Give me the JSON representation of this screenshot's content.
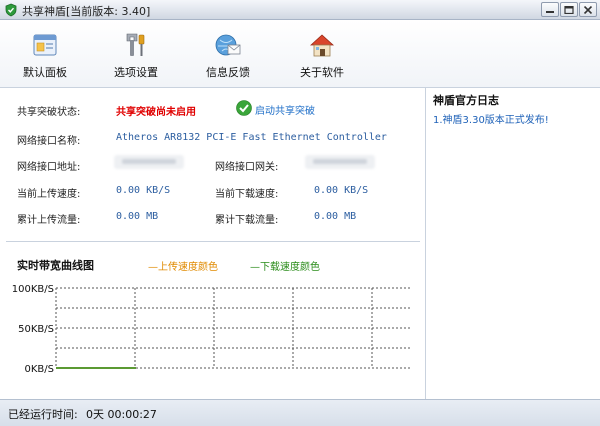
{
  "window": {
    "title": "共享神盾[当前版本: 3.40]"
  },
  "toolbar": {
    "items": [
      {
        "label": "默认面板",
        "icon": "panel-icon"
      },
      {
        "label": "选项设置",
        "icon": "tools-icon"
      },
      {
        "label": "信息反馈",
        "icon": "feedback-icon"
      },
      {
        "label": "关于软件",
        "icon": "house-icon"
      }
    ]
  },
  "status": {
    "state_label": "共享突破状态:",
    "state_value": "共享突破尚未启用",
    "start_label": "启动共享突破",
    "iface_name_label": "网络接口名称:",
    "iface_name_value": "Atheros AR8132 PCI-E Fast Ethernet Controller",
    "iface_addr_label": "网络接口地址:",
    "iface_gw_label": "网络接口网关:",
    "up_speed_label": "当前上传速度:",
    "up_speed_value": "0.00 KB/S",
    "down_speed_label": "当前下载速度:",
    "down_speed_value": "0.00 KB/S",
    "up_total_label": "累计上传流量:",
    "up_total_value": "0.00 MB",
    "down_total_label": "累计下载流量:",
    "down_total_value": "0.00 MB"
  },
  "chart": {
    "title": "实时带宽曲线图",
    "legend_up": "—上传速度颜色",
    "legend_down": "—下载速度颜色",
    "up_color": "#e08a00",
    "down_color": "#2a8c1a"
  },
  "chart_data": {
    "type": "line",
    "title": "实时带宽曲线图",
    "yticks": [
      "100KB/S",
      "50KB/S",
      "0KB/S"
    ],
    "ylim": [
      0,
      100
    ],
    "grid": true,
    "series": [
      {
        "name": "上传速度",
        "values": [
          0,
          0,
          0,
          0,
          0
        ]
      },
      {
        "name": "下载速度",
        "values": [
          0,
          0,
          0,
          0,
          0
        ]
      }
    ]
  },
  "sidebar": {
    "title": "神盾官方日志",
    "items": [
      "1.神盾3.30版本正式发布!"
    ]
  },
  "statusbar": {
    "uptime_label": "已经运行时间:",
    "uptime_value": "0天 00:00:27"
  }
}
